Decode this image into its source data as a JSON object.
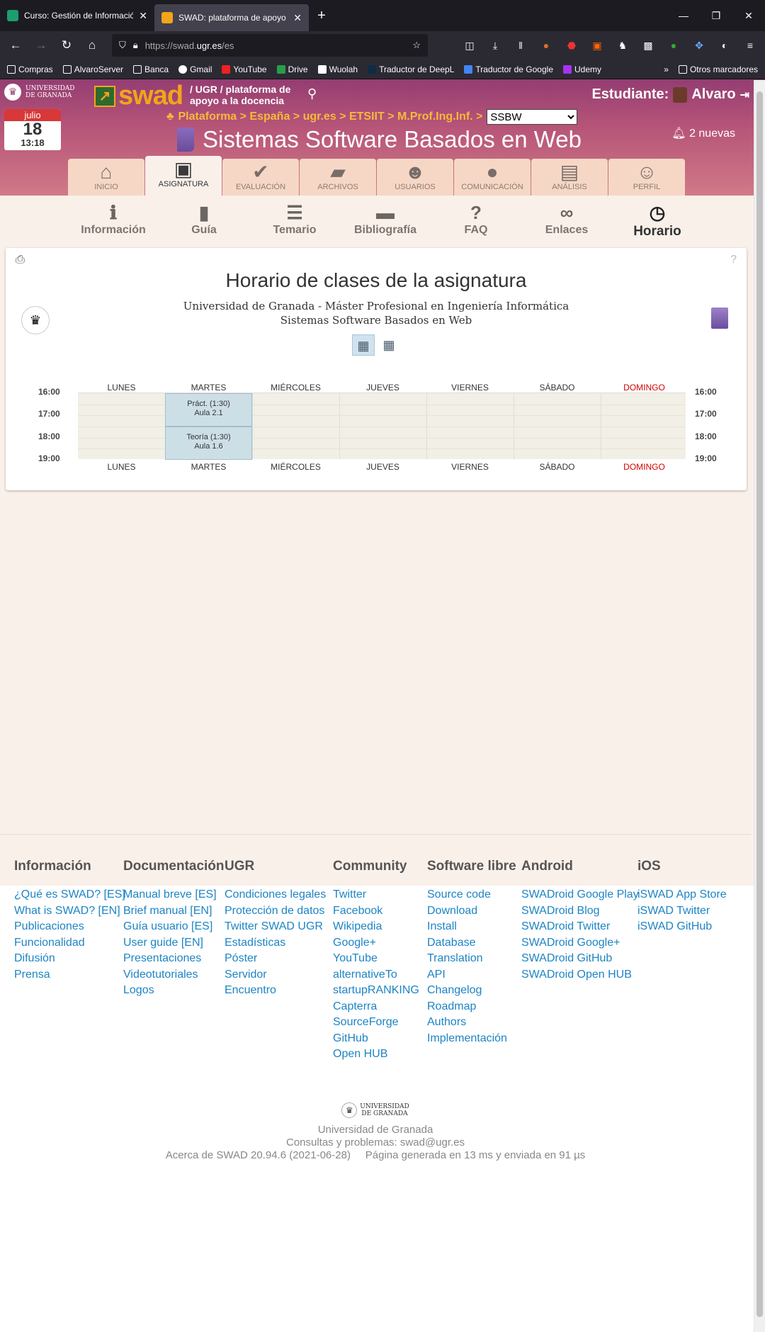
{
  "browser": {
    "tabs": [
      {
        "title": "Curso: Gestión de Información en",
        "active": false
      },
      {
        "title": "SWAD: plataforma de apoyo a la",
        "active": true
      }
    ],
    "url_prefix": "https://swad.",
    "url_domain": "ugr.es",
    "url_path": "/es",
    "bookmarks": [
      "Compras",
      "AlvaroServer",
      "Banca",
      "Gmail",
      "YouTube",
      "Drive",
      "Wuolah",
      "Traductor de DeepL",
      "Traductor de Google",
      "Udemy"
    ],
    "other_bookmarks": "Otros marcadores"
  },
  "header": {
    "ugr_line1": "UNIVERSIDAD",
    "ugr_line2": "DE GRANADA",
    "swad": "swad",
    "platform_line1": "/ UGR / plataforma de",
    "platform_line2": "apoyo a la docencia",
    "student_label": "Estudiante:",
    "student_name": "Alvaro",
    "cal_month": "julio",
    "cal_day": "18",
    "cal_time": "13:18",
    "breadcrumb": "Plataforma > España > ugr.es > ETSIIT > M.Prof.Ing.Inf. >",
    "course_select": "SSBW",
    "course_title": "Sistemas Software Basados en Web",
    "notifications": "2 nuevas"
  },
  "menu": [
    {
      "label": "INICIO",
      "icon": "home-icon",
      "glyph": "⌂"
    },
    {
      "label": "ASIGNATURA",
      "icon": "teacher-board-icon",
      "glyph": "▣"
    },
    {
      "label": "EVALUACIÓN",
      "icon": "check-icon",
      "glyph": "✔"
    },
    {
      "label": "ARCHIVOS",
      "icon": "folder-icon",
      "glyph": "▰"
    },
    {
      "label": "USUARIOS",
      "icon": "users-icon",
      "glyph": "☻"
    },
    {
      "label": "COMUNICACIÓN",
      "icon": "chat-icon",
      "glyph": "●"
    },
    {
      "label": "ANÁLISIS",
      "icon": "bar-chart-icon",
      "glyph": "▤"
    },
    {
      "label": "PERFIL",
      "icon": "user-icon",
      "glyph": "☺"
    }
  ],
  "submenu": [
    {
      "label": "Información",
      "icon": "info-icon",
      "glyph": "ℹ"
    },
    {
      "label": "Guía",
      "icon": "book-open-icon",
      "glyph": "▮"
    },
    {
      "label": "Temario",
      "icon": "list-icon",
      "glyph": "☰"
    },
    {
      "label": "Bibliografía",
      "icon": "book-icon",
      "glyph": "▬"
    },
    {
      "label": "FAQ",
      "icon": "question-icon",
      "glyph": "?"
    },
    {
      "label": "Enlaces",
      "icon": "link-icon",
      "glyph": "∞"
    },
    {
      "label": "Horario",
      "icon": "clock-icon",
      "glyph": "◷"
    }
  ],
  "timetable": {
    "title": "Horario de clases de la asignatura",
    "institution_line1": "Universidad de Granada - Máster Profesional en Ingeniería Informática",
    "institution_line2": "Sistemas Software Basados en Web",
    "days": [
      "LUNES",
      "MARTES",
      "MIÉRCOLES",
      "JUEVES",
      "VIERNES",
      "SÁBADO",
      "DOMINGO"
    ],
    "hours": [
      "16:00",
      "17:00",
      "18:00",
      "19:00"
    ],
    "classes": [
      {
        "day": "MARTES",
        "start": "16:00",
        "end": "17:30",
        "line1": "Práct. (1:30)",
        "line2": "Aula 2.1"
      },
      {
        "day": "MARTES",
        "start": "17:30",
        "end": "19:00",
        "line1": "Teoría (1:30)",
        "line2": "Aula 1.6"
      }
    ]
  },
  "footer": {
    "columns": [
      {
        "title": "Información",
        "links": [
          "¿Qué es SWAD? [ES]",
          "What is SWAD? [EN]",
          "Publicaciones",
          "Funcionalidad",
          "Difusión",
          "Prensa"
        ]
      },
      {
        "title": "Documentación",
        "links": [
          "Manual breve [ES]",
          "Brief manual [EN]",
          "Guía usuario [ES]",
          "User guide [EN]",
          "Presentaciones",
          "Videotutoriales",
          "Logos"
        ]
      },
      {
        "title": "UGR",
        "links": [
          "Condiciones legales",
          "Protección de datos",
          "Twitter SWAD UGR",
          "Estadísticas",
          "Póster",
          "Servidor",
          "Encuentro"
        ]
      },
      {
        "title": "Community",
        "links": [
          "Twitter",
          "Facebook",
          "Wikipedia",
          "Google+",
          "YouTube",
          "alternativeTo",
          "startupRANKING",
          "Capterra",
          "SourceForge",
          "GitHub",
          "Open HUB"
        ]
      },
      {
        "title": "Software libre",
        "links": [
          "Source code",
          "Download",
          "Install",
          "Database",
          "Translation",
          "API",
          "Changelog",
          "Roadmap",
          "Authors",
          "Implementación"
        ]
      },
      {
        "title": "Android",
        "links": [
          "SWADroid Google Play",
          "SWADroid Blog",
          "SWADroid Twitter",
          "SWADroid Google+",
          "SWADroid GitHub",
          "SWADroid Open HUB"
        ]
      },
      {
        "title": "iOS",
        "links": [
          "iSWAD App Store",
          "iSWAD Twitter",
          "iSWAD GitHub"
        ]
      }
    ],
    "university": "Universidad de Granada",
    "contact": "Consultas y problemas: swad@ugr.es",
    "version": "Acerca de SWAD 20.94.6 (2021-06-28)",
    "generated": "Página generada en 13 ms y enviada en 91 µs"
  }
}
